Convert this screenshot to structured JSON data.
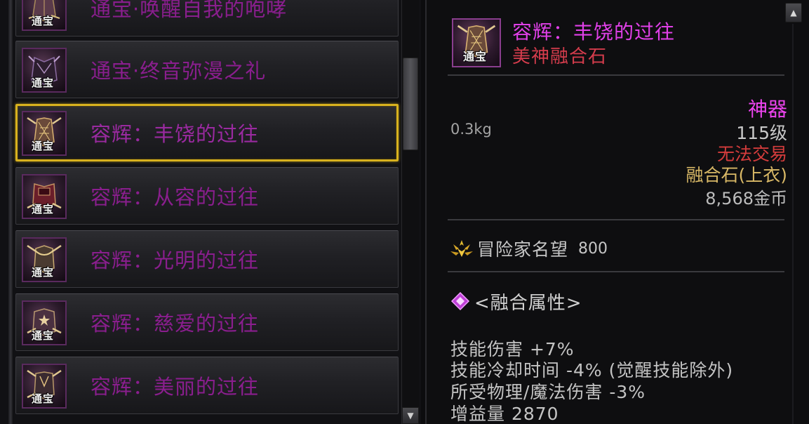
{
  "item_list": {
    "items": [
      {
        "label": "通宝·唤醒自我的咆哮",
        "icon": "robe-icon",
        "badge": "通宝",
        "selected": false
      },
      {
        "label": "通宝·终音弥漫之礼",
        "icon": "dark-coat-icon",
        "badge": "通宝",
        "selected": false
      },
      {
        "label": "容辉：丰饶的过往",
        "icon": "ornate-robe-icon",
        "badge": "通宝",
        "selected": true
      },
      {
        "label": "容辉：从容的过往",
        "icon": "crimson-jacket-icon",
        "badge": "通宝",
        "selected": false
      },
      {
        "label": "容辉：光明的过往",
        "icon": "gold-collar-icon",
        "badge": "通宝",
        "selected": false
      },
      {
        "label": "容辉：慈爱的过往",
        "icon": "star-cape-icon",
        "badge": "通宝",
        "selected": false
      },
      {
        "label": "容辉：美丽的过往",
        "icon": "wing-coat-icon",
        "badge": "通宝",
        "selected": false
      }
    ],
    "scroll_down_glyph": "▼"
  },
  "detail": {
    "icon": "ornate-robe-icon",
    "badge": "通宝",
    "name": "容辉：丰饶的过往",
    "type": "美神融合石",
    "weight": "0.3kg",
    "rarity": "神器",
    "level": "115级",
    "trade": "无法交易",
    "slot": "融合石(上衣)",
    "gold": "8,568金币",
    "fame_label": "冒险家名望",
    "fame_value": "800",
    "fusion_header": "<融合属性>",
    "stats": [
      "技能伤害 +7%",
      "技能冷却时间 -4% (觉醒技能除外)",
      "所受物理/魔法伤害 -3%",
      "增益量 2870"
    ],
    "scroll_up_glyph": "▲"
  },
  "colors": {
    "item_label": "#8a1e8e",
    "selected_border": "#d8b21e",
    "item_name": "#e040e8",
    "item_type": "#d43c4c",
    "rarity": "#ee44f0",
    "untradeable": "#d43c3c",
    "slot": "#d8b866"
  }
}
